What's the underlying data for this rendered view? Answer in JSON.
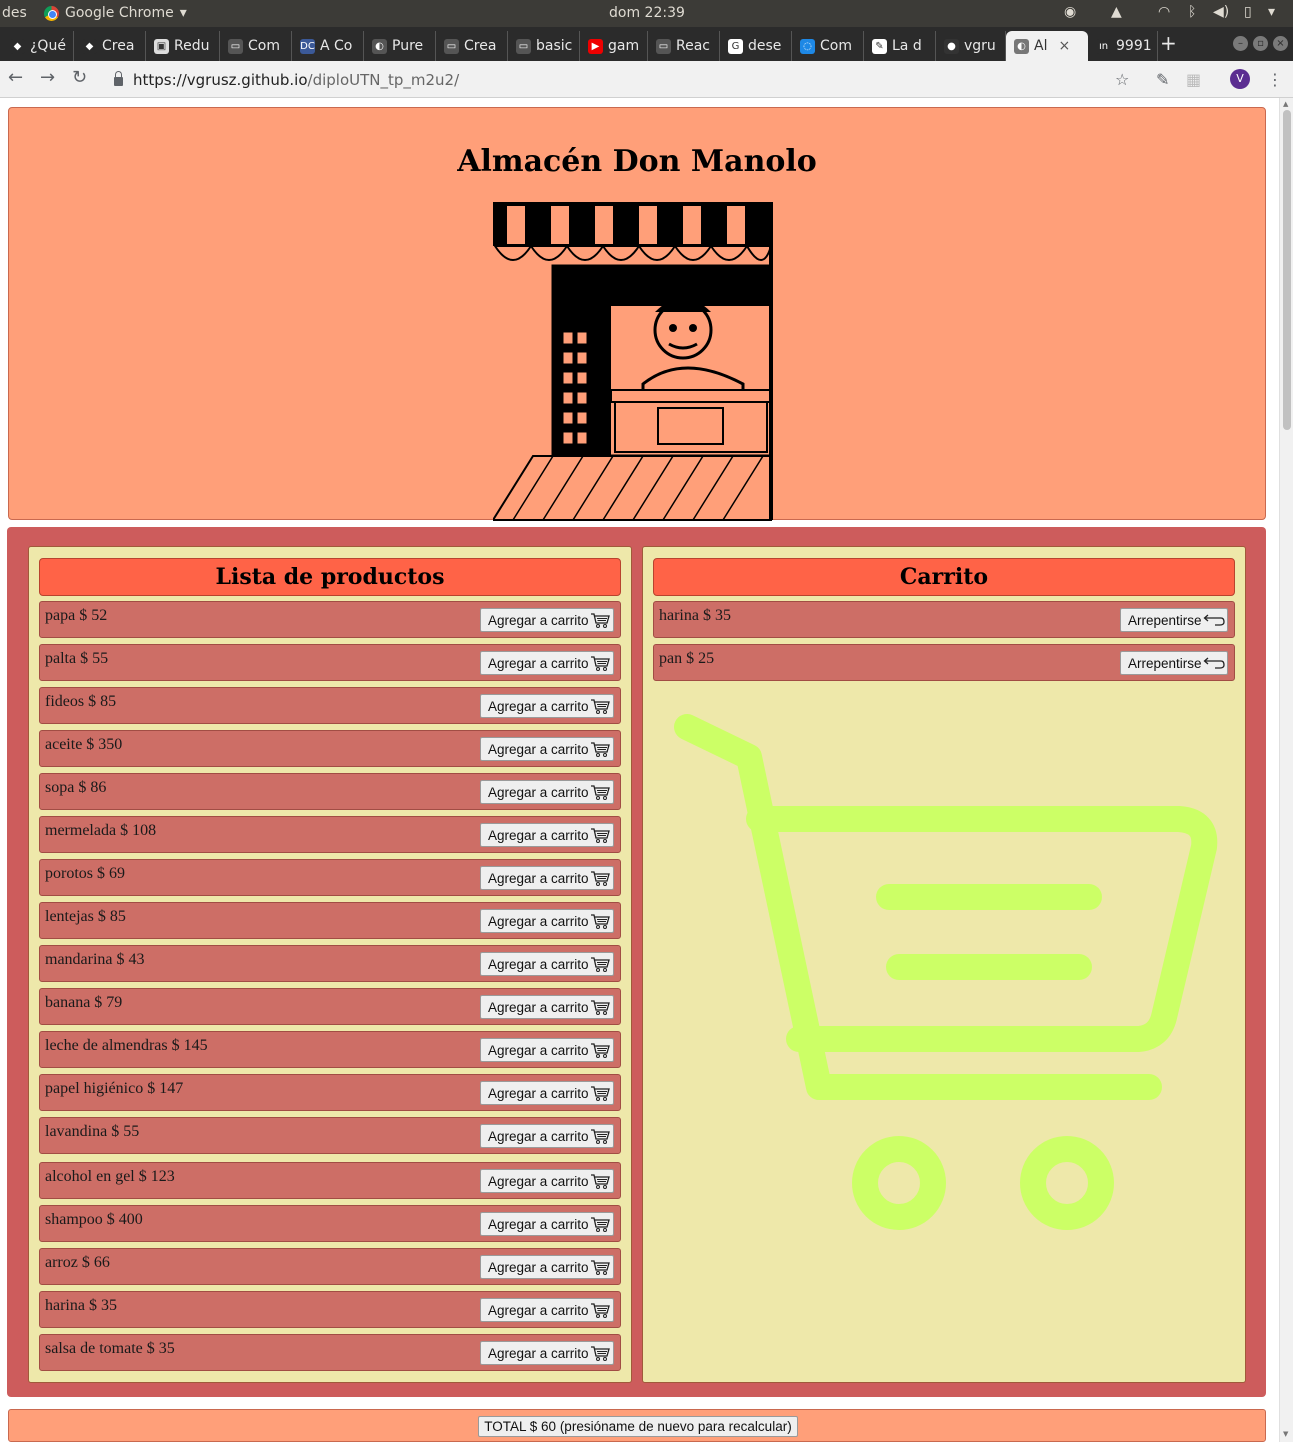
{
  "os_bar": {
    "left_label": "des",
    "app_name": "Google Chrome",
    "clock": "dom 22:39"
  },
  "tabs": [
    {
      "label": "¿Qué",
      "fav_color": "#2b2b2b",
      "fav_text": "◆",
      "icon": "codecademy-icon"
    },
    {
      "label": "Crea",
      "fav_color": "#2b2b2b",
      "fav_text": "◆",
      "icon": "codecademy-icon"
    },
    {
      "label": "Redu",
      "fav_color": "#ddd",
      "fav_text": "▣",
      "icon": "avatar-icon"
    },
    {
      "label": "Com",
      "fav_color": "#555",
      "fav_text": "▭",
      "icon": "folder-icon"
    },
    {
      "label": "A Co",
      "fav_color": "#3b5998",
      "fav_text": "DC",
      "icon": "dc-icon"
    },
    {
      "label": "Pure",
      "fav_color": "#555",
      "fav_text": "◐",
      "icon": "globe-icon"
    },
    {
      "label": "Crea",
      "fav_color": "#555",
      "fav_text": "▭",
      "icon": "folder-icon"
    },
    {
      "label": "basic",
      "fav_color": "#555",
      "fav_text": "▭",
      "icon": "folder-icon"
    },
    {
      "label": "gam",
      "fav_color": "#e00",
      "fav_text": "▶",
      "icon": "youtube-icon"
    },
    {
      "label": "Reac",
      "fav_color": "#555",
      "fav_text": "▭",
      "icon": "folder-icon"
    },
    {
      "label": "dese",
      "fav_color": "#fff",
      "fav_text": "G",
      "icon": "google-icon"
    },
    {
      "label": "Com",
      "fav_color": "#1e88e5",
      "fav_text": "◌",
      "icon": "loader-icon"
    },
    {
      "label": "La d",
      "fav_color": "#fff",
      "fav_text": "✎",
      "icon": "bookmark-icon"
    },
    {
      "label": "vgru",
      "fav_color": "#333",
      "fav_text": "●",
      "icon": "github-icon"
    },
    {
      "label": "Al",
      "fav_color": "#777",
      "fav_text": "◐",
      "icon": "globe-icon"
    },
    {
      "label": "9991",
      "fav_color": "#2b2b2b",
      "fav_text": "ın",
      "icon": "stats-icon"
    }
  ],
  "toolbar": {
    "url_host": "https://vgrusz.github.io",
    "url_path": "/diploUTN_tp_m2u2/",
    "profile_initial": "V"
  },
  "store": {
    "title": "Almacén Don Manolo"
  },
  "products": {
    "title": "Lista de productos",
    "add_label": "Agregar a carrito",
    "items": [
      {
        "text": "papa $ 52"
      },
      {
        "text": "palta $ 55"
      },
      {
        "text": "fideos $ 85"
      },
      {
        "text": "aceite $ 350"
      },
      {
        "text": "sopa $ 86"
      },
      {
        "text": "mermelada $ 108"
      },
      {
        "text": "porotos $ 69"
      },
      {
        "text": "lentejas $ 85"
      },
      {
        "text": "mandarina $ 43"
      },
      {
        "text": "banana $ 79"
      },
      {
        "text": "leche de almendras $ 145"
      },
      {
        "text": "papel higiénico $ 147"
      },
      {
        "text": "lavandina $ 55"
      },
      {
        "text": "alcohol en gel $ 123"
      },
      {
        "text": "shampoo $ 400"
      },
      {
        "text": "arroz $ 66"
      },
      {
        "text": "harina $ 35"
      },
      {
        "text": "salsa de tomate $ 35"
      }
    ]
  },
  "cart": {
    "title": "Carrito",
    "remove_label": "Arrepentirse",
    "items": [
      {
        "text": "harina $ 35"
      },
      {
        "text": "pan $ 25"
      }
    ]
  },
  "total": {
    "label": "TOTAL $ 60 (presióname de nuevo para recalcular)"
  },
  "colors": {
    "header_bg": "#ff9f79",
    "section_bg": "#cd5c5c",
    "panel_bg": "#eee8aa",
    "title_bg": "#ff6347",
    "row_bg": "#cd6e66",
    "watermark": "#ccff66"
  }
}
